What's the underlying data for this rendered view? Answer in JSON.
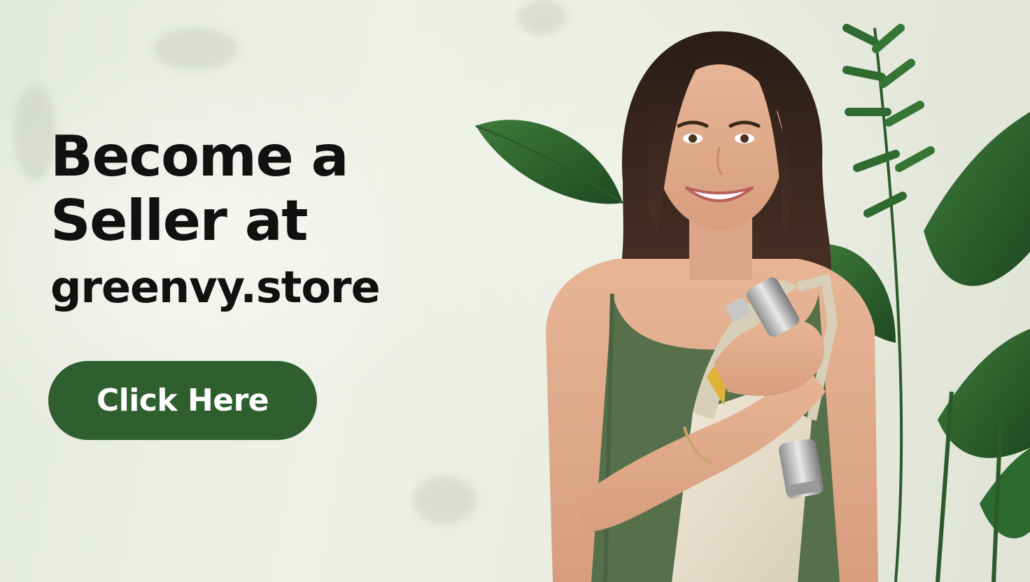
{
  "hero": {
    "headline_line1": "Become a",
    "headline_line2": "Seller at",
    "domain": "greenvy.store",
    "cta_label": "Click Here"
  },
  "colors": {
    "cta_background": "#2f5f2f",
    "cta_text": "#ffffff",
    "headline_text": "#111111",
    "tank_top": "#55704a",
    "tote_bag": "#e6dfcd"
  },
  "icons": [
    "plant-leaves-icon",
    "woman-photo",
    "steel-flask-icon",
    "tote-bag-icon"
  ]
}
